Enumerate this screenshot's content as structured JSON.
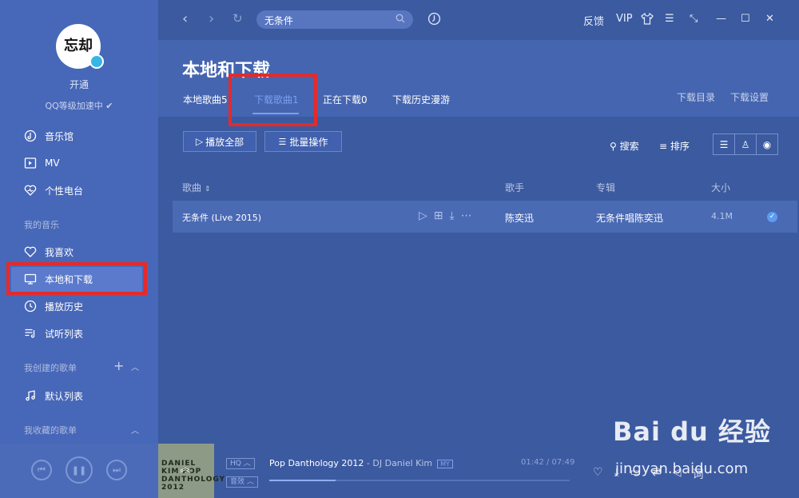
{
  "sidebar": {
    "avatar_text": "忘却",
    "open_label": "开通",
    "qq_level": "QQ等级加速中",
    "items_main": [
      {
        "label": "音乐馆",
        "icon": "music-hall-icon"
      },
      {
        "label": "MV",
        "icon": "mv-icon"
      },
      {
        "label": "个性电台",
        "icon": "radio-icon"
      }
    ],
    "my_music_label": "我的音乐",
    "items_my": [
      {
        "label": "我喜欢",
        "icon": "heart-icon"
      },
      {
        "label": "本地和下载",
        "icon": "monitor-icon"
      },
      {
        "label": "播放历史",
        "icon": "clock-icon"
      },
      {
        "label": "试听列表",
        "icon": "playlist-icon"
      }
    ],
    "created_label": "我创建的歌单",
    "default_list": "默认列表",
    "collected_label": "我收藏的歌单"
  },
  "topbar": {
    "search_value": "无条件",
    "feedback": "反馈",
    "vip": "VIP"
  },
  "header": {
    "title": "本地和下载",
    "tabs": [
      "本地歌曲5",
      "下载歌曲1",
      "正在下载0",
      "下载历史漫游"
    ],
    "download_dir": "下载目录",
    "download_settings": "下载设置"
  },
  "toolbar": {
    "play_all": "播放全部",
    "batch": "批量操作",
    "search": "搜索",
    "sort": "排序"
  },
  "table": {
    "columns": [
      "歌曲",
      "歌手",
      "专辑",
      "大小"
    ],
    "rows": [
      {
        "song": "无条件 (Live 2015)",
        "artist": "陈奕迅",
        "album": "无条件唱陈奕迅",
        "size": "4.1M"
      }
    ]
  },
  "player": {
    "song": "Pop Danthology 2012",
    "artist": " - DJ Daniel Kim",
    "my_badge": "MY",
    "quality": "HQ",
    "effect": "音效",
    "time": "01:42 / 07:49",
    "progress": 0.22,
    "cover_text": "DANIEL KIM POP DANTHOLOGY 2012"
  },
  "watermark": {
    "main": "Bai du 经验",
    "sub": "jingyan.baidu.com"
  },
  "colors": {
    "sidebar": "#4767b8",
    "main": "#3b5a9f",
    "accent": "#7aa0f0",
    "highlight": "#e52a2a"
  }
}
